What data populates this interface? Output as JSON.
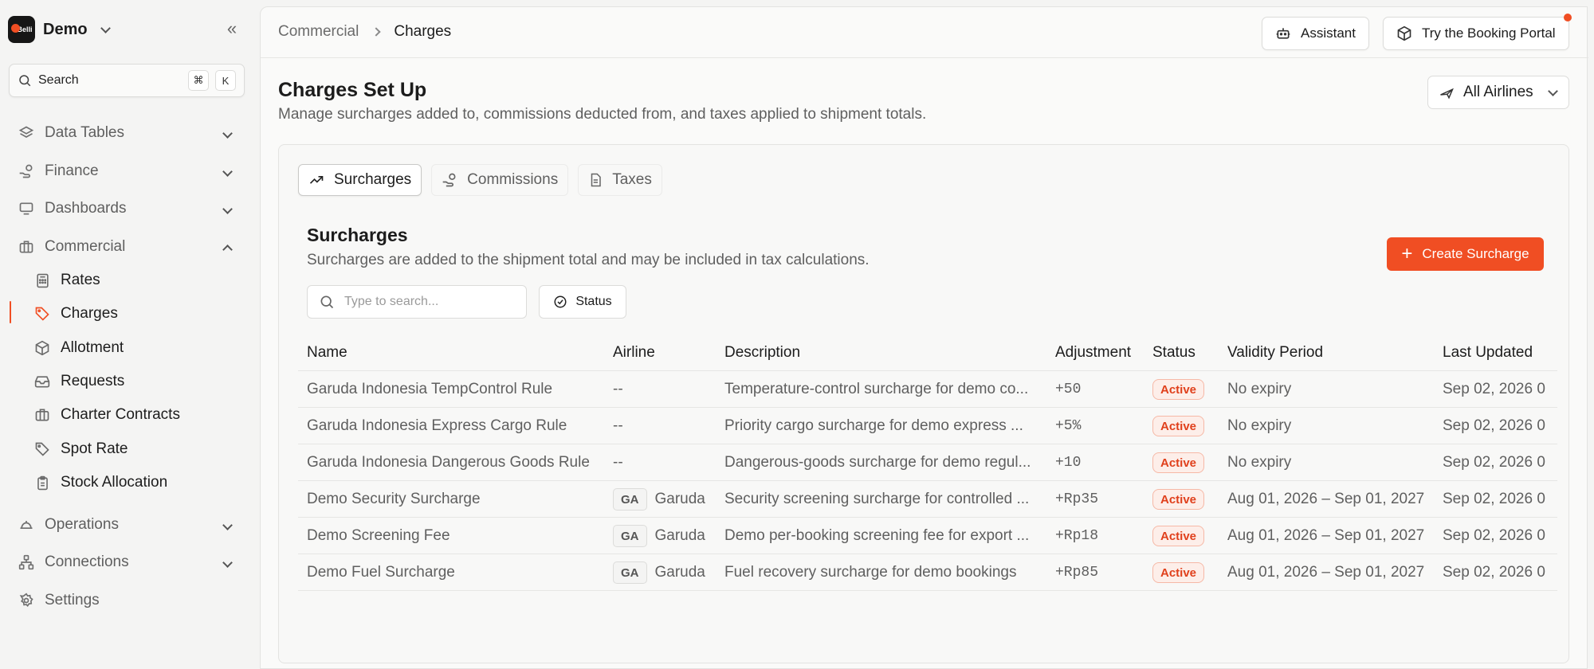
{
  "workspace": {
    "name": "Demo",
    "logo_text": "Belli"
  },
  "sidebar": {
    "search_label": "Search",
    "shortcut": [
      "⌘",
      "K"
    ],
    "items": [
      {
        "label": "Data Tables",
        "icon": "layers-icon"
      },
      {
        "label": "Finance",
        "icon": "hand-coins-icon"
      },
      {
        "label": "Dashboards",
        "icon": "monitor-icon"
      },
      {
        "label": "Commercial",
        "icon": "briefcase-icon",
        "expanded": true
      },
      {
        "label": "Operations",
        "icon": "plane-icon"
      },
      {
        "label": "Connections",
        "icon": "network-icon"
      },
      {
        "label": "Settings",
        "icon": "gear-icon"
      }
    ],
    "commercial_sub": [
      {
        "label": "Rates",
        "icon": "calculator-icon"
      },
      {
        "label": "Charges",
        "icon": "tag-icon",
        "active": true
      },
      {
        "label": "Allotment",
        "icon": "package-icon"
      },
      {
        "label": "Requests",
        "icon": "inbox-icon"
      },
      {
        "label": "Charter Contracts",
        "icon": "briefcase-icon"
      },
      {
        "label": "Spot Rate",
        "icon": "tag-icon"
      },
      {
        "label": "Stock Allocation",
        "icon": "clipboard-icon"
      }
    ]
  },
  "header": {
    "breadcrumb": [
      "Commercial",
      "Charges"
    ],
    "assistant_label": "Assistant",
    "portal_label": "Try the Booking Portal"
  },
  "page": {
    "title": "Charges Set Up",
    "subtitle": "Manage surcharges added to, commissions deducted from, and taxes applied to shipment totals.",
    "airline_filter": "All Airlines"
  },
  "tabs": [
    {
      "label": "Surcharges",
      "active": true
    },
    {
      "label": "Commissions"
    },
    {
      "label": "Taxes"
    }
  ],
  "section": {
    "title": "Surcharges",
    "subtitle": "Surcharges are added to the shipment total and may be included in tax calculations.",
    "create_label": "Create Surcharge",
    "search_placeholder": "Type to search...",
    "status_filter": "Status"
  },
  "table": {
    "columns": [
      "Name",
      "Airline",
      "Description",
      "Adjustment",
      "Status",
      "Validity Period",
      "Last Updated"
    ],
    "rows": [
      {
        "name": "Garuda Indonesia TempControl Rule",
        "airline_code": "",
        "airline": "--",
        "description": "Temperature-control surcharge for demo co...",
        "adjustment": "+50",
        "status": "Active",
        "validity": "No expiry",
        "updated": "Sep 02, 2026 0"
      },
      {
        "name": "Garuda Indonesia Express Cargo Rule",
        "airline_code": "",
        "airline": "--",
        "description": "Priority cargo surcharge for demo express ...",
        "adjustment": "+5%",
        "status": "Active",
        "validity": "No expiry",
        "updated": "Sep 02, 2026 0"
      },
      {
        "name": "Garuda Indonesia Dangerous Goods Rule",
        "airline_code": "",
        "airline": "--",
        "description": "Dangerous-goods surcharge for demo regul...",
        "adjustment": "+10",
        "status": "Active",
        "validity": "No expiry",
        "updated": "Sep 02, 2026 0"
      },
      {
        "name": "Demo Security Surcharge",
        "airline_code": "GA",
        "airline": "Garuda",
        "description": "Security screening surcharge for controlled ...",
        "adjustment": "+Rp35",
        "status": "Active",
        "validity": "Aug 01, 2026 – Sep 01, 2027",
        "updated": "Sep 02, 2026 0"
      },
      {
        "name": "Demo Screening Fee",
        "airline_code": "GA",
        "airline": "Garuda",
        "description": "Demo per-booking screening fee for export ...",
        "adjustment": "+Rp18",
        "status": "Active",
        "validity": "Aug 01, 2026 – Sep 01, 2027",
        "updated": "Sep 02, 2026 0"
      },
      {
        "name": "Demo Fuel Surcharge",
        "airline_code": "GA",
        "airline": "Garuda",
        "description": "Fuel recovery surcharge for demo bookings",
        "adjustment": "+Rp85",
        "status": "Active",
        "validity": "Aug 01, 2026 – Sep 01, 2027",
        "updated": "Sep 02, 2026 0"
      }
    ]
  },
  "colors": {
    "accent": "#f04e23",
    "badge_bg": "#fdeee9",
    "badge_border": "#f6b8a6"
  }
}
